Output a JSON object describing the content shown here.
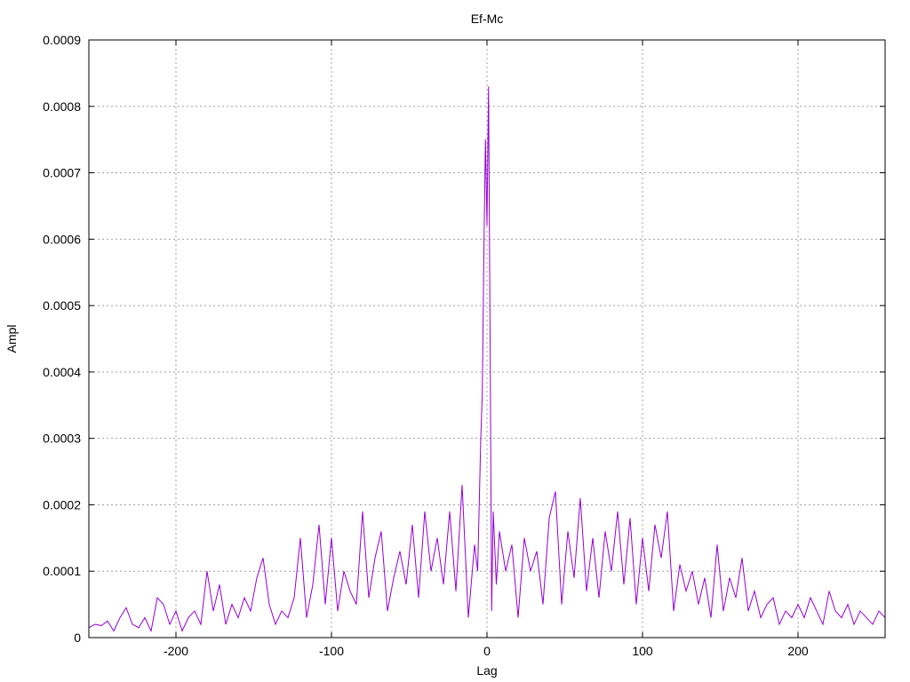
{
  "chart_data": {
    "type": "line",
    "title": "Ef-Mc",
    "xlabel": "Lag",
    "ylabel": "Ampl",
    "xlim": [
      -256,
      256
    ],
    "ylim": [
      0,
      0.0009
    ],
    "xticks": [
      -200,
      -100,
      0,
      100,
      200
    ],
    "xtick_labels": [
      "-200",
      "-100",
      "0",
      "100",
      "200"
    ],
    "yticks": [
      0,
      0.0001,
      0.0002,
      0.0003,
      0.0004,
      0.0005,
      0.0006,
      0.0007,
      0.0008,
      0.0009
    ],
    "ytick_labels": [
      "0",
      "0.0001",
      "0.0002",
      "0.0003",
      "0.0004",
      "0.0005",
      "0.0006",
      "0.0007",
      "0.0008",
      "0.0009"
    ],
    "grid": true,
    "legend": "none",
    "series_color": "#9400d3",
    "series": [
      {
        "x": [
          -256,
          -252,
          -248,
          -244,
          -240,
          -236,
          -232,
          -228,
          -224,
          -220,
          -216,
          -212,
          -208,
          -204,
          -200,
          -196,
          -192,
          -188,
          -184,
          -180,
          -176,
          -172,
          -168,
          -164,
          -160,
          -156,
          -152,
          -148,
          -144,
          -140,
          -136,
          -132,
          -128,
          -124,
          -120,
          -116,
          -112,
          -108,
          -104,
          -100,
          -96,
          -92,
          -88,
          -84,
          -80,
          -76,
          -72,
          -68,
          -64,
          -60,
          -56,
          -52,
          -48,
          -44,
          -40,
          -36,
          -32,
          -28,
          -24,
          -20,
          -16,
          -12,
          -8,
          -6,
          -4,
          -3,
          -2,
          -1,
          0,
          1,
          2,
          3,
          4,
          6,
          8,
          12,
          16,
          20,
          24,
          28,
          32,
          36,
          40,
          44,
          48,
          52,
          56,
          60,
          64,
          68,
          72,
          76,
          80,
          84,
          88,
          92,
          96,
          100,
          104,
          108,
          112,
          116,
          120,
          124,
          128,
          132,
          136,
          140,
          144,
          148,
          152,
          156,
          160,
          164,
          168,
          172,
          176,
          180,
          184,
          188,
          192,
          196,
          200,
          204,
          208,
          212,
          216,
          220,
          224,
          228,
          232,
          236,
          240,
          244,
          248,
          252,
          256
        ],
        "values": [
          1.5e-05,
          2e-05,
          1.8e-05,
          2.5e-05,
          1e-05,
          3e-05,
          4.5e-05,
          2e-05,
          1.5e-05,
          3e-05,
          1e-05,
          6e-05,
          5e-05,
          2e-05,
          4e-05,
          1e-05,
          3e-05,
          4e-05,
          2e-05,
          0.0001,
          4e-05,
          8e-05,
          2e-05,
          5e-05,
          3e-05,
          6e-05,
          4e-05,
          9e-05,
          0.00012,
          5e-05,
          2e-05,
          4e-05,
          3e-05,
          6e-05,
          0.00015,
          3e-05,
          8e-05,
          0.00017,
          5e-05,
          0.00015,
          4e-05,
          0.0001,
          7e-05,
          5e-05,
          0.00019,
          6e-05,
          0.00012,
          0.00016,
          4e-05,
          9e-05,
          0.00013,
          8e-05,
          0.00017,
          6e-05,
          0.00019,
          0.0001,
          0.00015,
          8e-05,
          0.00019,
          7e-05,
          0.00023,
          3e-05,
          0.00014,
          0.0001,
          0.0003,
          0.00037,
          0.00058,
          0.00075,
          0.00062,
          0.00083,
          0.00045,
          4e-05,
          0.00019,
          8e-05,
          0.00016,
          0.0001,
          0.00014,
          3e-05,
          0.00015,
          0.0001,
          0.00013,
          5e-05,
          0.00018,
          0.00022,
          5e-05,
          0.00016,
          9e-05,
          0.00021,
          7e-05,
          0.00015,
          6e-05,
          0.00016,
          0.0001,
          0.00019,
          8e-05,
          0.00018,
          5e-05,
          0.00015,
          7e-05,
          0.00017,
          0.00012,
          0.00019,
          4e-05,
          0.00011,
          7e-05,
          0.0001,
          5e-05,
          9e-05,
          3e-05,
          0.00014,
          4e-05,
          9e-05,
          6e-05,
          0.00012,
          4e-05,
          7e-05,
          3e-05,
          5e-05,
          6e-05,
          2e-05,
          4e-05,
          3e-05,
          5e-05,
          3e-05,
          6e-05,
          4e-05,
          2e-05,
          7e-05,
          4e-05,
          3e-05,
          5e-05,
          2e-05,
          4e-05,
          3e-05,
          2e-05,
          4e-05,
          3e-05
        ]
      }
    ]
  }
}
